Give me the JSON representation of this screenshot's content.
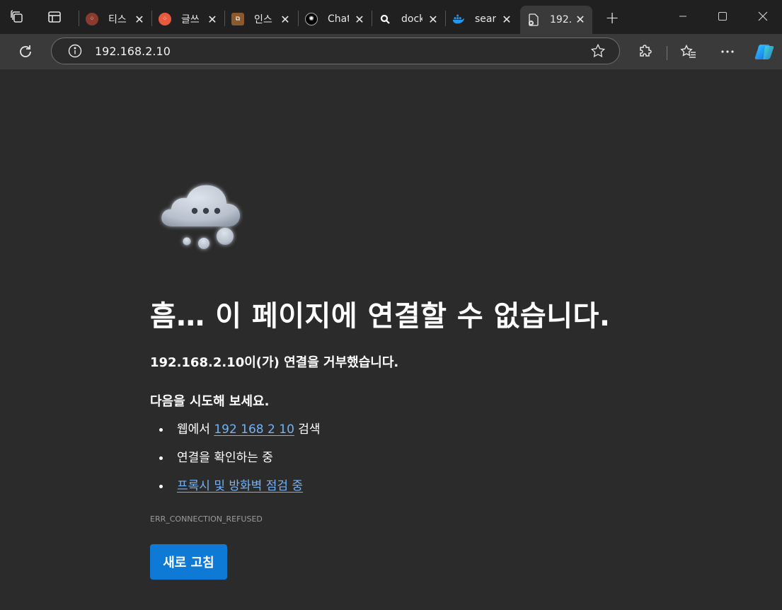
{
  "tabs": [
    {
      "title": "티스",
      "favicon": "tistory-icon",
      "color": "#8a3a2e"
    },
    {
      "title": "글쓰",
      "favicon": "tistory-icon",
      "color": "#e85a3e"
    },
    {
      "title": "인스",
      "favicon": "instance-icon",
      "color": "#8a5a2e"
    },
    {
      "title": "Chat",
      "favicon": "chatgpt-icon",
      "color": "#000000"
    },
    {
      "title": "dock",
      "favicon": "search-icon",
      "color": "#111111"
    },
    {
      "title": "sear",
      "favicon": "docker-icon",
      "color": "#2496ed"
    },
    {
      "title": "192.",
      "favicon": "broken-page-icon",
      "color": "#3a3a3a",
      "active": true
    }
  ],
  "address_bar": {
    "url": "192.168.2.10"
  },
  "error_page": {
    "title": "흠… 이 페이지에 연결할 수 없습니다.",
    "subtitle": "192.168.2.10이(가) 연결을 거부했습니다.",
    "try_heading": "다음을 시도해 보세요.",
    "suggestions": [
      {
        "prefix": "웹에서 ",
        "link": "192 168 2 10",
        "suffix": " 검색"
      },
      {
        "text": "연결을 확인하는 중"
      },
      {
        "link": "프록시 및 방화벽 점검 중"
      }
    ],
    "error_code": "ERR_CONNECTION_REFUSED",
    "reload_label": "새로 고침"
  },
  "colors": {
    "accent": "#0f7ad6",
    "link": "#74b2f4",
    "background": "#2b2b2b"
  }
}
